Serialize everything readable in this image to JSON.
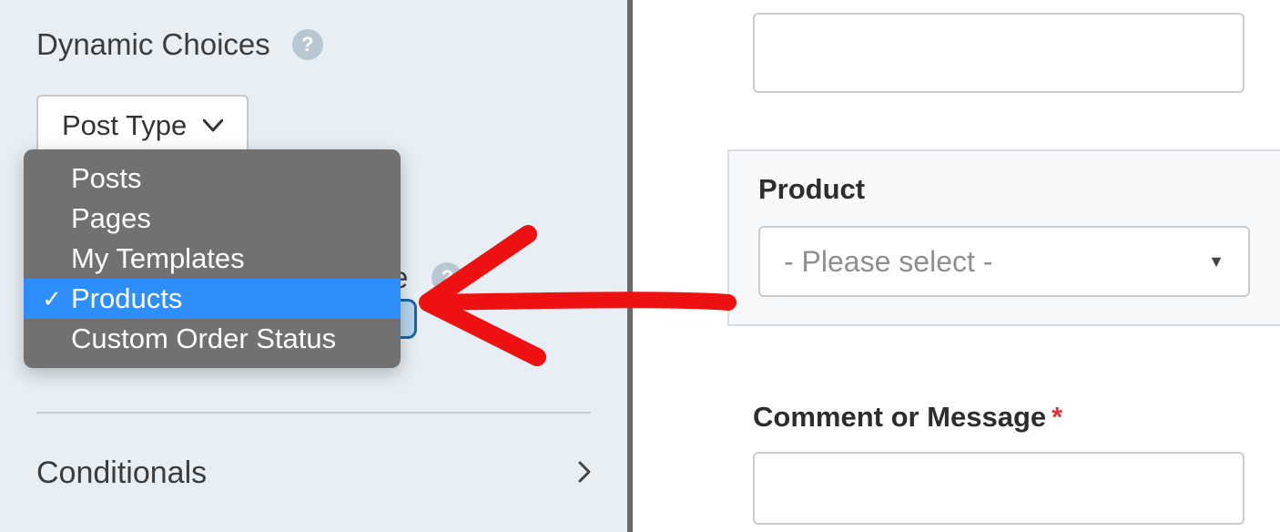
{
  "left": {
    "dynamic_choices_label": "Dynamic Choices",
    "select_label": "Post Type",
    "options": [
      "Posts",
      "Pages",
      "My Templates",
      "Products",
      "Custom Order Status"
    ],
    "selected_index": 3,
    "peek_letter": "e",
    "conditionals_label": "Conditionals"
  },
  "right": {
    "product_label": "Product",
    "product_placeholder": "- Please select -",
    "comment_label": "Comment or Message",
    "required_mark": "*"
  }
}
